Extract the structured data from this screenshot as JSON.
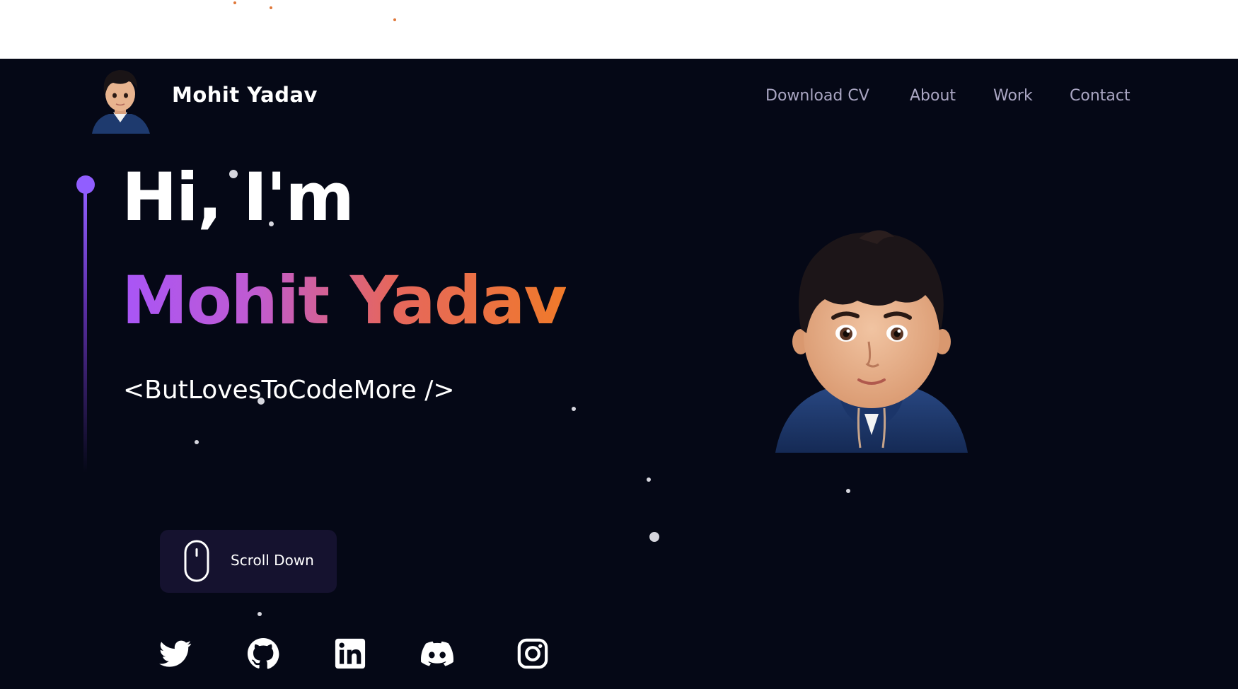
{
  "header": {
    "brand": "Mohit  Yadav",
    "nav": [
      {
        "label": "Download CV"
      },
      {
        "label": "About"
      },
      {
        "label": "Work"
      },
      {
        "label": "Contact"
      }
    ]
  },
  "hero": {
    "greeting": "Hi, I'm",
    "name": "Mohit Yadav",
    "tagline": "<ButLovesToCodeMore />"
  },
  "scroll": {
    "label": "Scroll Down",
    "icon": "mouse-icon"
  },
  "social": [
    {
      "icon": "twitter-icon"
    },
    {
      "icon": "github-icon"
    },
    {
      "icon": "linkedin-icon"
    },
    {
      "icon": "discord-icon"
    },
    {
      "icon": "instagram-icon"
    }
  ],
  "colors": {
    "background": "#050816",
    "accent": "#915eff",
    "name_gradient_start": "#a855f7",
    "name_gradient_end": "#f07a2a",
    "nav_text": "#aaa6c3",
    "button_bg": "#15122f"
  }
}
